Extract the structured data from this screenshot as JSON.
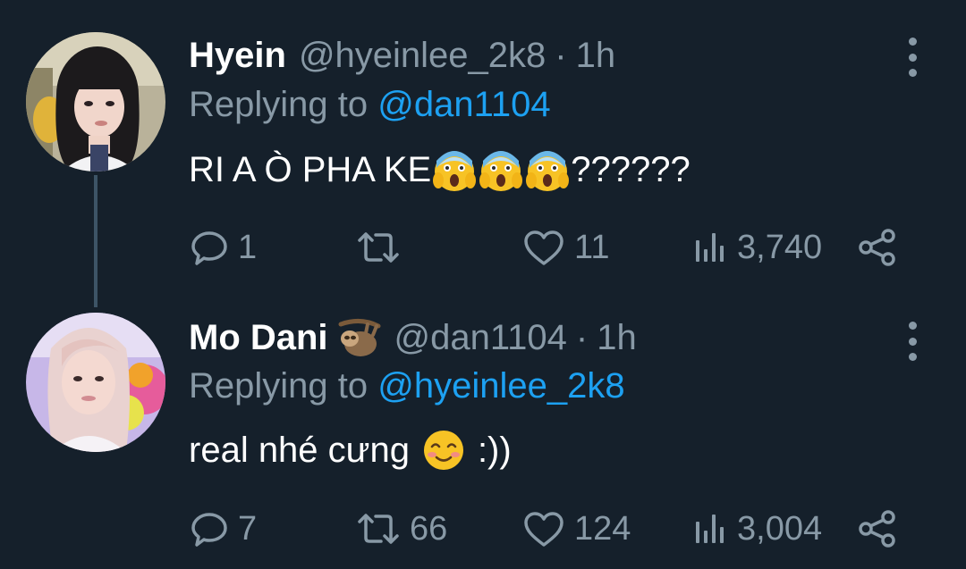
{
  "tweets": [
    {
      "display_name": "Hyein",
      "handle": "@hyeinlee_2k8",
      "separator": "·",
      "time": "1h",
      "replying_prefix": "Replying to",
      "replying_to": "@dan1104",
      "text_before_emoji": "RI A Ò PHA KE",
      "text_after_emoji": "??????",
      "emojis": [
        "face-screaming-in-fear",
        "face-screaming-in-fear",
        "face-screaming-in-fear"
      ],
      "counts": {
        "replies": "1",
        "retweets": "",
        "likes": "11",
        "views": "3,740"
      }
    },
    {
      "display_name": "Mo Dani",
      "name_emoji": "sloth",
      "handle": "@dan1104",
      "separator": "·",
      "time": "1h",
      "replying_prefix": "Replying to",
      "replying_to": "@hyeinlee_2k8",
      "text_before_emoji": "real nhé cưng",
      "text_after_emoji": ":))",
      "emojis": [
        "smiling-face"
      ],
      "counts": {
        "replies": "7",
        "retweets": "66",
        "likes": "124",
        "views": "3,004"
      }
    }
  ],
  "colors": {
    "background": "#15202b",
    "secondary_text": "#8899a6",
    "link": "#1da1f2",
    "thread_line": "#3d5466"
  },
  "icons": [
    "reply-icon",
    "retweet-icon",
    "like-icon",
    "views-icon",
    "share-icon",
    "more-icon"
  ]
}
